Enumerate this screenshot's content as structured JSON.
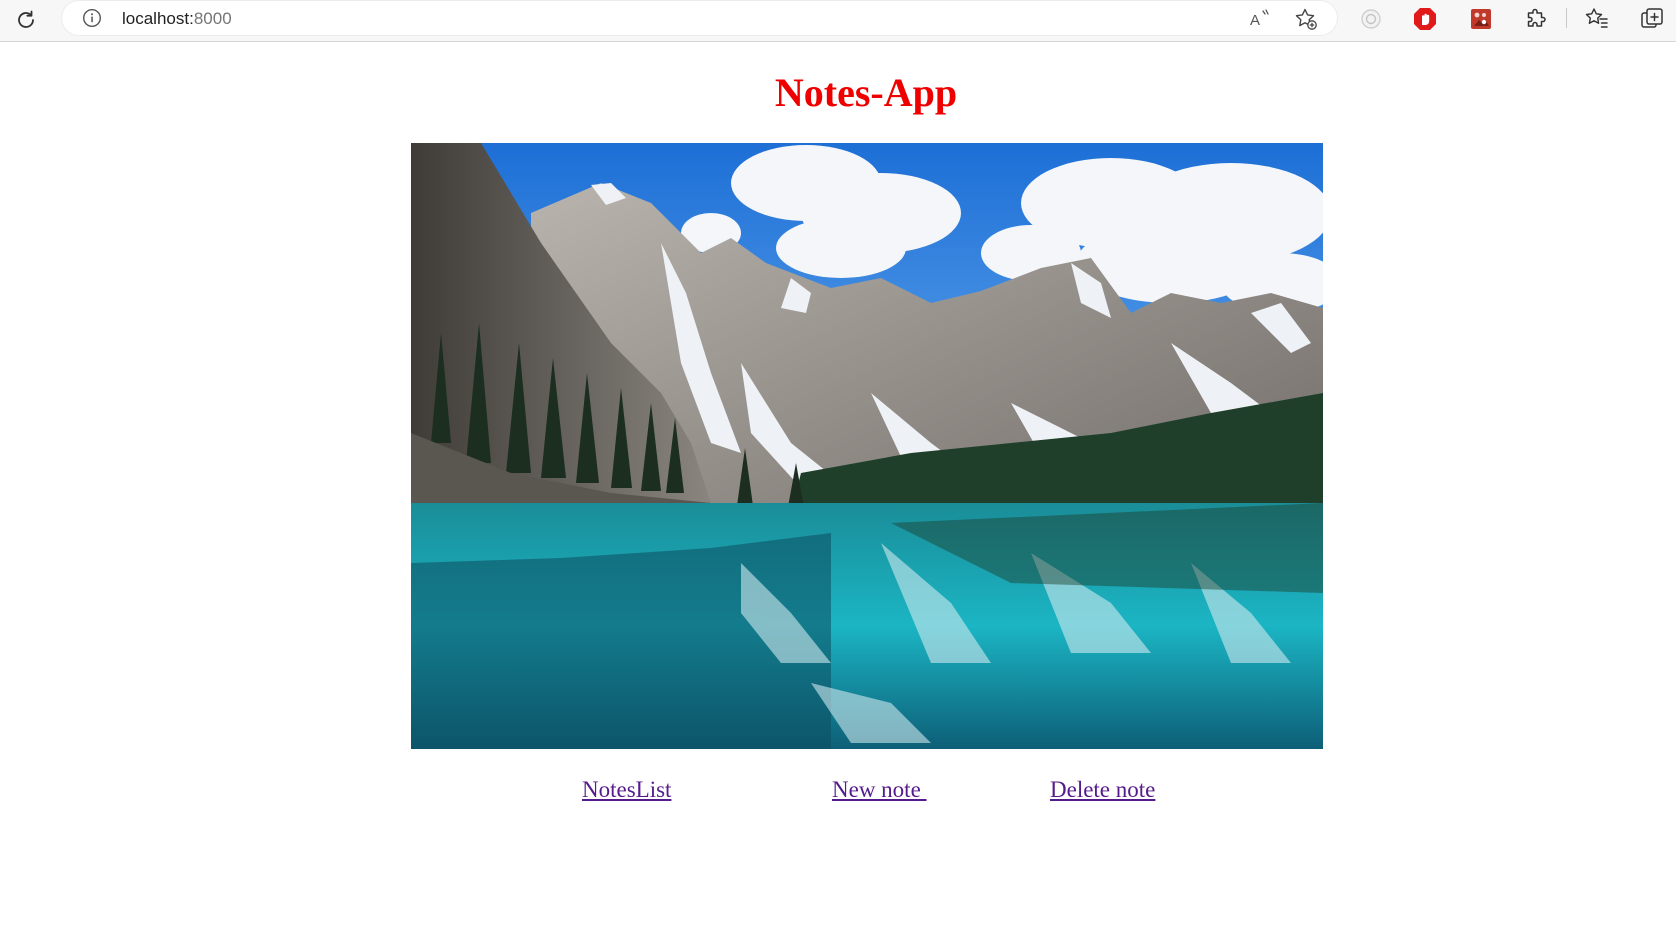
{
  "browser": {
    "url_host": "localhost:",
    "url_port": "8000",
    "icons": {
      "reload": "reload-icon",
      "info": "info-icon",
      "read_aloud": "read-aloud-icon",
      "add_favorite": "add-favorite-icon",
      "extension_gray": "extension-circle-icon",
      "extension_red": "adblock-icon",
      "extension_picture": "image-extension-icon",
      "extensions": "puzzle-icon",
      "favorites": "favorites-icon",
      "collections": "collections-icon"
    }
  },
  "page": {
    "title": "Notes-App",
    "title_color": "#ee0000",
    "hero_image": "mountain-lake-photo",
    "links": [
      {
        "label": "NotesList"
      },
      {
        "label": "New note "
      },
      {
        "label": "Delete note"
      }
    ],
    "link_color": "#551a8b"
  }
}
